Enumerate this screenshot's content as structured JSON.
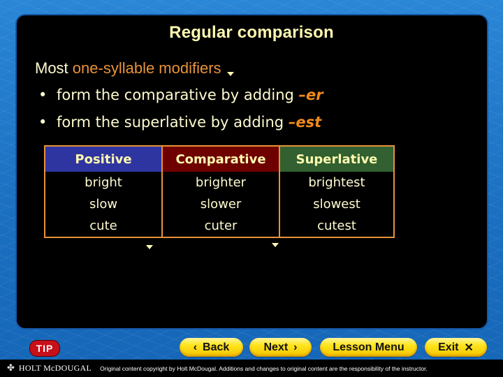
{
  "slide": {
    "title": "Regular comparison",
    "intro_prefix": "Most ",
    "intro_highlight": "one-syllable modifiers",
    "bullets": [
      {
        "text": "form the comparative by adding ",
        "suffix": "–er"
      },
      {
        "text": "form the superlative by adding ",
        "suffix": "–est"
      }
    ],
    "bullet_glyph": "•"
  },
  "table": {
    "headers": [
      "Positive",
      "Comparative",
      "Superlative"
    ],
    "header_colors": [
      "#2f35a0",
      "#6e0000",
      "#326030"
    ],
    "rows": [
      [
        "bright",
        "brighter",
        "brightest"
      ],
      [
        "slow",
        "slower",
        "slowest"
      ],
      [
        "cute",
        "cuter",
        "cutest"
      ]
    ]
  },
  "nav": {
    "tip_label": "TIP",
    "back_label": "Back",
    "back_icon": "‹",
    "next_label": "Next",
    "next_icon": "›",
    "menu_label": "Lesson Menu",
    "exit_label": "Exit",
    "exit_icon": "✕"
  },
  "footer": {
    "logo_icon": "✤",
    "brand": "HOLT McDOUGAL",
    "copyright": "Original content copyright by Holt McDougal.  Additions and changes to original content are the responsibility of the instructor."
  },
  "colors": {
    "title": "#fffab0",
    "accent": "#e8923a",
    "suffix": "#f08a1a"
  }
}
